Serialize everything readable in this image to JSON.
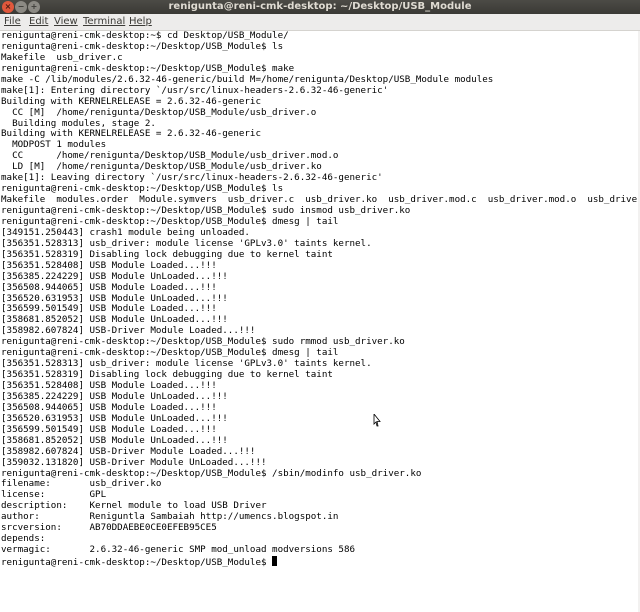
{
  "window": {
    "title": "renigunta@reni-cmk-desktop: ~/Desktop/USB_Module",
    "close_glyph": "×",
    "minimize_glyph": "−",
    "maximize_glyph": "+"
  },
  "menu": {
    "file": "File",
    "edit": "Edit",
    "view": "View",
    "terminal": "Terminal",
    "help": "Help"
  },
  "terminal": {
    "lines": [
      "renigunta@reni-cmk-desktop:~$ cd Desktop/USB_Module/",
      "renigunta@reni-cmk-desktop:~/Desktop/USB_Module$ ls",
      "Makefile  usb_driver.c",
      "renigunta@reni-cmk-desktop:~/Desktop/USB_Module$ make",
      "make -C /lib/modules/2.6.32-46-generic/build M=/home/renigunta/Desktop/USB_Module modules",
      "make[1]: Entering directory `/usr/src/linux-headers-2.6.32-46-generic'",
      "Building with KERNELRELEASE = 2.6.32-46-generic",
      "  CC [M]  /home/renigunta/Desktop/USB_Module/usb_driver.o",
      "  Building modules, stage 2.",
      "Building with KERNELRELEASE = 2.6.32-46-generic",
      "  MODPOST 1 modules",
      "  CC      /home/renigunta/Desktop/USB_Module/usb_driver.mod.o",
      "  LD [M]  /home/renigunta/Desktop/USB_Module/usb_driver.ko",
      "make[1]: Leaving directory `/usr/src/linux-headers-2.6.32-46-generic'",
      "renigunta@reni-cmk-desktop:~/Desktop/USB_Module$ ls",
      "Makefile  modules.order  Module.symvers  usb_driver.c  usb_driver.ko  usb_driver.mod.c  usb_driver.mod.o  usb_driver.o",
      "renigunta@reni-cmk-desktop:~/Desktop/USB_Module$ sudo insmod usb_driver.ko",
      "renigunta@reni-cmk-desktop:~/Desktop/USB_Module$ dmesg | tail",
      "[349151.250443] crash1 module being unloaded.",
      "[356351.528313] usb_driver: module license 'GPLv3.0' taints kernel.",
      "[356351.528319] Disabling lock debugging due to kernel taint",
      "[356351.528408] USB Module Loaded...!!!",
      "[356385.224229] USB Module UnLoaded...!!!",
      "[356508.944065] USB Module Loaded...!!!",
      "[356520.631953] USB Module UnLoaded...!!!",
      "[356599.501549] USB Module Loaded...!!!",
      "[358681.852052] USB Module UnLoaded...!!!",
      "[358982.607824] USB-Driver Module Loaded...!!!",
      "renigunta@reni-cmk-desktop:~/Desktop/USB_Module$ sudo rmmod usb_driver.ko",
      "renigunta@reni-cmk-desktop:~/Desktop/USB_Module$ dmesg | tail",
      "[356351.528313] usb_driver: module license 'GPLv3.0' taints kernel.",
      "[356351.528319] Disabling lock debugging due to kernel taint",
      "[356351.528408] USB Module Loaded...!!!",
      "[356385.224229] USB Module UnLoaded...!!!",
      "[356508.944065] USB Module Loaded...!!!",
      "[356520.631953] USB Module UnLoaded...!!!",
      "[356599.501549] USB Module Loaded...!!!",
      "[358681.852052] USB Module UnLoaded...!!!",
      "[358982.607824] USB-Driver Module Loaded...!!!",
      "[359032.131820] USB-Driver Module UnLoaded...!!!",
      "renigunta@reni-cmk-desktop:~/Desktop/USB_Module$ /sbin/modinfo usb_driver.ko",
      "filename:       usb_driver.ko",
      "license:        GPL",
      "description:    Kernel module to load USB Driver",
      "author:         Reniguntla Sambaiah http://umencs.blogspot.in",
      "srcversion:     AB70DDAEBE0CE0EFEB95CE5",
      "depends:        ",
      "vermagic:       2.6.32-46-generic SMP mod_unload modversions 586"
    ],
    "prompt": "renigunta@reni-cmk-desktop:~/Desktop/USB_Module$ "
  },
  "colors": {
    "title_bg": "#3c3b37",
    "title_fg": "#dfdbd2",
    "menu_bg": "#edeceb",
    "terminal_bg": "#ffffff",
    "terminal_fg": "#000000",
    "close_button": "#e2583c"
  },
  "icons": {
    "close": "close-icon",
    "minimize": "minimize-icon",
    "maximize": "maximize-icon",
    "mouse": "mouse-pointer-icon"
  }
}
